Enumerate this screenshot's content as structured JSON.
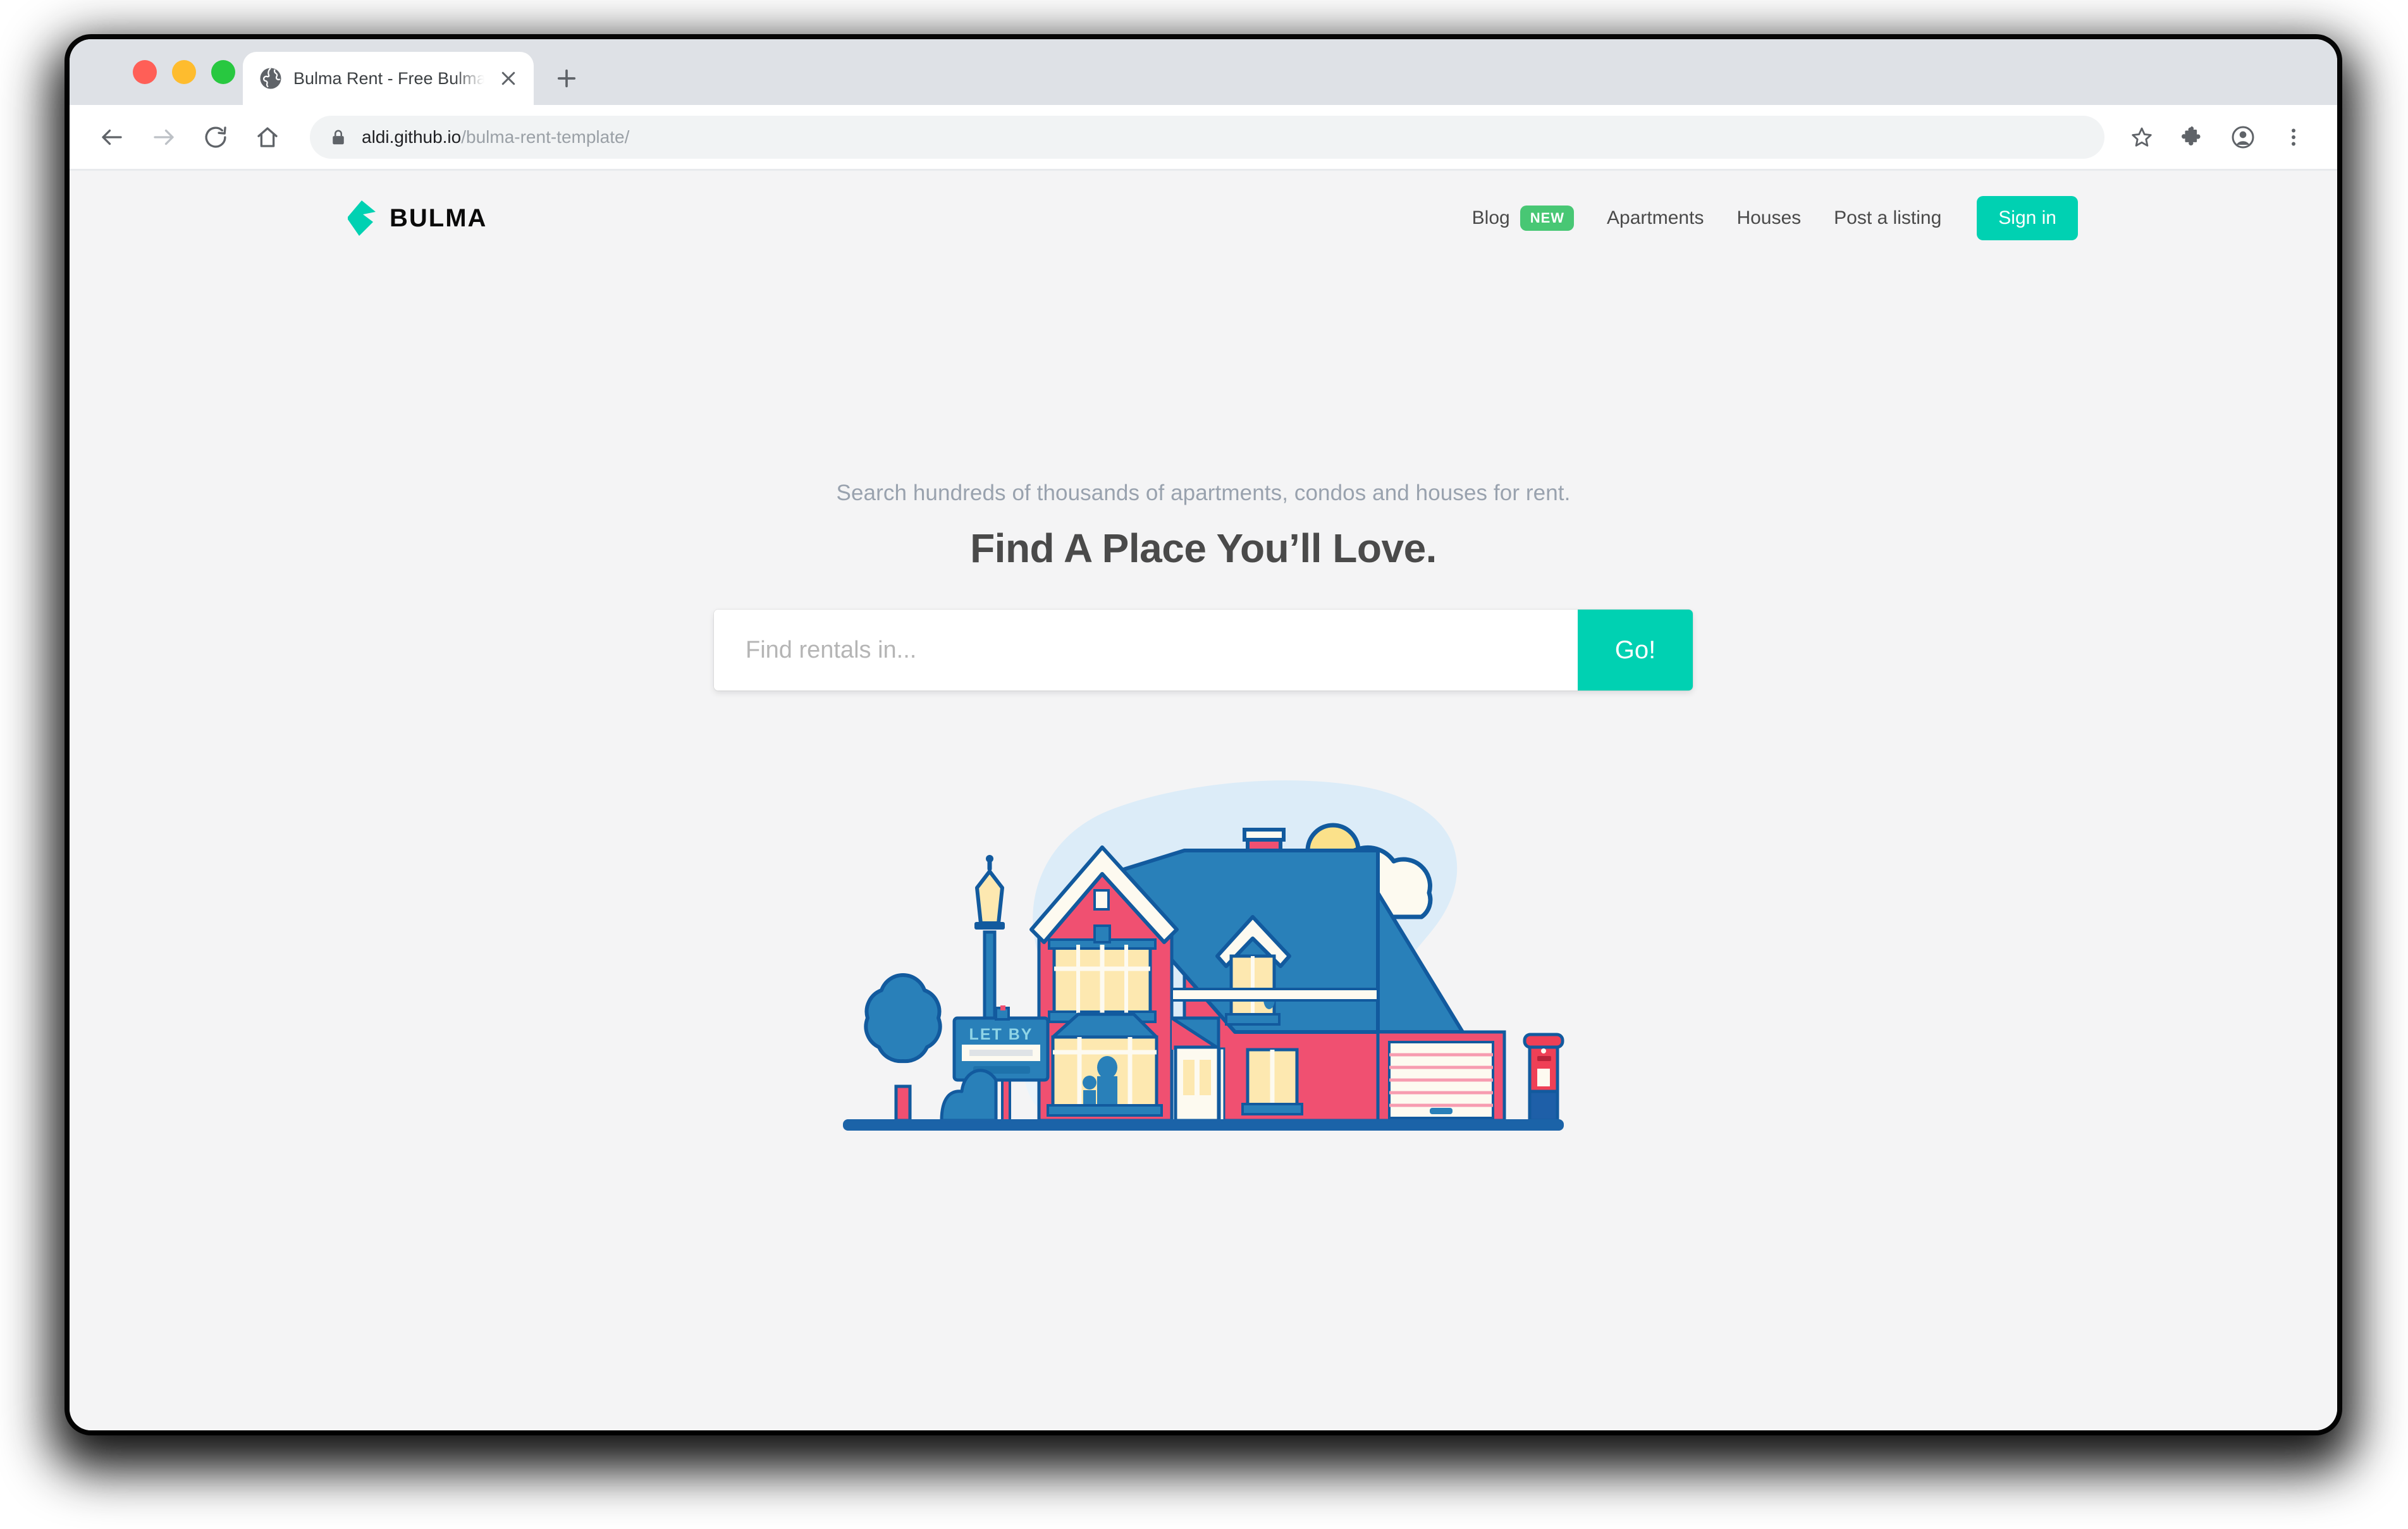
{
  "browser": {
    "tab": {
      "title": "Bulma Rent - Free Bulma Temp",
      "favicon_icon": "globe-icon",
      "close_icon": "close-icon"
    },
    "new_tab_icon": "plus-icon",
    "traffic_lights": {
      "close": "#ff5f57",
      "minimize": "#febc2e",
      "maximize": "#28c840"
    },
    "toolbar": {
      "back_icon": "arrow-left-icon",
      "forward_icon": "arrow-right-icon",
      "reload_icon": "reload-icon",
      "home_icon": "home-icon",
      "lock_icon": "lock-icon",
      "url_host": "aldi.github.io",
      "url_path": "/bulma-rent-template/",
      "bookmark_icon": "star-icon",
      "extensions_icon": "puzzle-icon",
      "profile_icon": "account-avatar-icon",
      "menu_icon": "three-dot-menu-icon"
    }
  },
  "site": {
    "brand": {
      "name": "BULMA",
      "logo_icon": "bulma-logo-icon"
    },
    "nav": [
      {
        "label": "Blog",
        "badge": "NEW"
      },
      {
        "label": "Apartments"
      },
      {
        "label": "Houses"
      },
      {
        "label": "Post a listing"
      }
    ],
    "signin_label": "Sign in",
    "hero": {
      "subtitle": "Search hundreds of thousands of apartments, condos and houses for rent.",
      "title": "Find A Place You’ll Love."
    },
    "search": {
      "value": "",
      "placeholder": "Find rentals in...",
      "button_label": "Go!"
    },
    "illustration": {
      "name": "house-for-rent-illustration",
      "sign_text": "LET BY"
    },
    "colors": {
      "primary": "#00d1b2",
      "badge_green": "#48c774",
      "page_bg": "#f4f4f5",
      "text_dark": "#4a4a4a",
      "text_muted": "#99a2ae",
      "house_pink": "#f05071",
      "roof_blue": "#2980b9",
      "outline_blue": "#125a9e",
      "window_cream": "#fde8b0",
      "cloud_white": "#fdfaf0",
      "sun_yellow": "#fbe18a",
      "sky_blue": "#dcecf8",
      "post_red": "#ef4056"
    }
  }
}
